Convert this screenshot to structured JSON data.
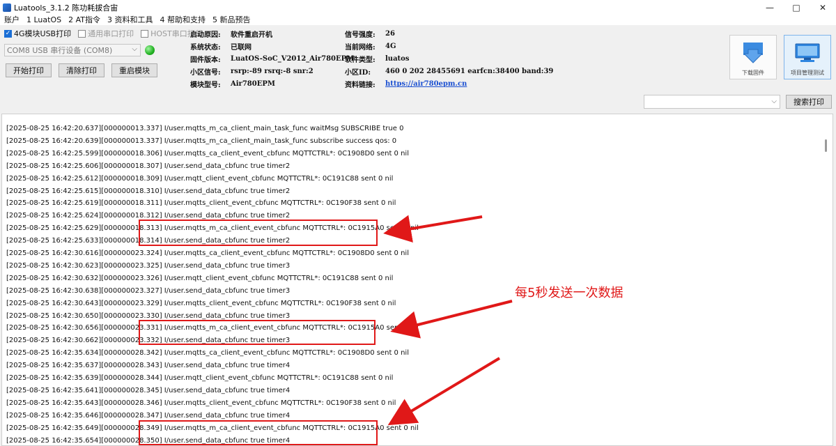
{
  "window": {
    "title": "Luatools_3.1.2 陈功耗拔合宙",
    "minimize": "—",
    "maximize": "□",
    "close": "✕"
  },
  "menu": [
    "账户",
    "1 LuatOS",
    "2 AT指令",
    "3 资料和工具",
    "4 帮助和支持",
    "5 新品预告"
  ],
  "checkboxes": [
    {
      "label": "4G模块USB打印",
      "checked": true,
      "disabled": false
    },
    {
      "label": "通用串口打印",
      "checked": false,
      "disabled": true
    },
    {
      "label": "HOST串口打印",
      "checked": false,
      "disabled": true
    }
  ],
  "port": {
    "value": "COM8 USB 串行设备 (COM8)"
  },
  "buttons": {
    "start": "开始打印",
    "clear": "清除打印",
    "restart": "重启模块",
    "search": "搜索打印"
  },
  "info_left": [
    {
      "k": "启动原因:",
      "v": "软件重启开机"
    },
    {
      "k": "系统状态:",
      "v": "已联网"
    },
    {
      "k": "固件版本:",
      "v": "LuatOS-SoC_V2012_Air780EPM"
    },
    {
      "k": "小区信号:",
      "v": "rsrp:-89 rsrq:-8 snr:2"
    },
    {
      "k": "模块型号:",
      "v": "Air780EPM"
    }
  ],
  "info_right": [
    {
      "k": "信号强度:",
      "v": "26"
    },
    {
      "k": "当前网络:",
      "v": "4G"
    },
    {
      "k": "软件类型:",
      "v": "luatos"
    },
    {
      "k": "小区ID:",
      "v": "460 0 202 28455691 earfcn:38400 band:39"
    },
    {
      "k": "资料链接:",
      "v": "https://air780epm.cn"
    }
  ],
  "tools": {
    "download": "下载固件",
    "project": "项目管理测试"
  },
  "log_lines": [
    "[2025-08-25 16:42:20.637][000000013.337] I/user.mqtts_m_ca_client_main_task_func waitMsg SUBSCRIBE true 0",
    "[2025-08-25 16:42:20.639][000000013.337] I/user.mqtts_m_ca_client_main_task_func subscribe success qos: 0",
    "[2025-08-25 16:42:25.599][000000018.306] I/user.mqtts_ca_client_event_cbfunc MQTTCTRL*: 0C1908D0 sent 0 nil",
    "[2025-08-25 16:42:25.606][000000018.307] I/user.send_data_cbfunc true timer2",
    "[2025-08-25 16:42:25.612][000000018.309] I/user.mqtt_client_event_cbfunc MQTTCTRL*: 0C191C88 sent 0 nil",
    "[2025-08-25 16:42:25.615][000000018.310] I/user.send_data_cbfunc true timer2",
    "[2025-08-25 16:42:25.619][000000018.311] I/user.mqtts_client_event_cbfunc MQTTCTRL*: 0C190F38 sent 0 nil",
    "[2025-08-25 16:42:25.624][000000018.312] I/user.send_data_cbfunc true timer2",
    "[2025-08-25 16:42:25.629][000000018.313] I/user.mqtts_m_ca_client_event_cbfunc MQTTCTRL*: 0C1915A0 sent 0 nil",
    "[2025-08-25 16:42:25.633][000000018.314] I/user.send_data_cbfunc true timer2",
    "[2025-08-25 16:42:30.616][000000023.324] I/user.mqtts_ca_client_event_cbfunc MQTTCTRL*: 0C1908D0 sent 0 nil",
    "[2025-08-25 16:42:30.623][000000023.325] I/user.send_data_cbfunc true timer3",
    "[2025-08-25 16:42:30.632][000000023.326] I/user.mqtt_client_event_cbfunc MQTTCTRL*: 0C191C88 sent 0 nil",
    "[2025-08-25 16:42:30.638][000000023.327] I/user.send_data_cbfunc true timer3",
    "[2025-08-25 16:42:30.643][000000023.329] I/user.mqtts_client_event_cbfunc MQTTCTRL*: 0C190F38 sent 0 nil",
    "[2025-08-25 16:42:30.650][000000023.330] I/user.send_data_cbfunc true timer3",
    "[2025-08-25 16:42:30.656][000000023.331] I/user.mqtts_m_ca_client_event_cbfunc MQTTCTRL*: 0C1915A0 sent 0 nil",
    "[2025-08-25 16:42:30.662][000000023.332] I/user.send_data_cbfunc true timer3",
    "[2025-08-25 16:42:35.634][000000028.342] I/user.mqtts_ca_client_event_cbfunc MQTTCTRL*: 0C1908D0 sent 0 nil",
    "[2025-08-25 16:42:35.637][000000028.343] I/user.send_data_cbfunc true timer4",
    "[2025-08-25 16:42:35.639][000000028.344] I/user.mqtt_client_event_cbfunc MQTTCTRL*: 0C191C88 sent 0 nil",
    "[2025-08-25 16:42:35.641][000000028.345] I/user.send_data_cbfunc true timer4",
    "[2025-08-25 16:42:35.643][000000028.346] I/user.mqtts_client_event_cbfunc MQTTCTRL*: 0C190F38 sent 0 nil",
    "[2025-08-25 16:42:35.646][000000028.347] I/user.send_data_cbfunc true timer4",
    "[2025-08-25 16:42:35.649][000000028.349] I/user.mqtts_m_ca_client_event_cbfunc MQTTCTRL*: 0C1915A0 sent 0 nil",
    "[2025-08-25 16:42:35.654][000000028.350] I/user.send_data_cbfunc true timer4"
  ],
  "annotation": {
    "text": "每5秒发送一次数据",
    "color": "#e01818"
  }
}
